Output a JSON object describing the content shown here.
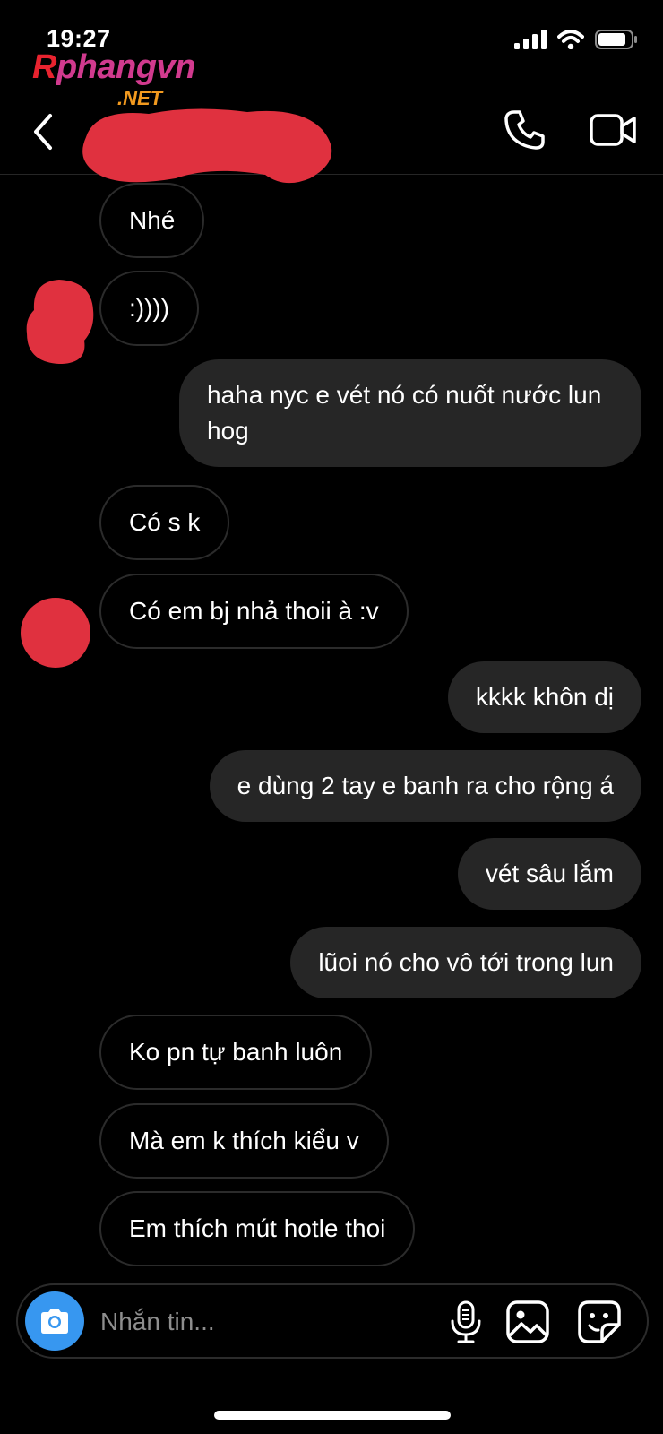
{
  "status_bar": {
    "time": "19:27",
    "icons": [
      "signal-icon",
      "wifi-icon",
      "battery-icon"
    ]
  },
  "watermark": {
    "main_r": "R",
    "main_rest": "phangvn",
    "sub": ".NET"
  },
  "header": {
    "back_icon": "chevron-left-icon",
    "call_icon": "phone-icon",
    "video_icon": "video-camera-icon",
    "redaction_color": "#e0313f"
  },
  "messages": [
    {
      "side": "in",
      "text": "Nhé"
    },
    {
      "side": "in",
      "text": ":))))"
    },
    {
      "side": "out",
      "text": "haha nyc e vét nó có nuốt nước lun hog"
    },
    {
      "side": "in",
      "text": "Có s k"
    },
    {
      "side": "in",
      "text": "Có em bj nhả thoii à :v"
    },
    {
      "side": "out",
      "text": "kkkk khôn dị"
    },
    {
      "side": "out",
      "text": "e dùng 2 tay e banh ra cho rộng á"
    },
    {
      "side": "out",
      "text": "vét sâu lắm"
    },
    {
      "side": "out",
      "text": "lũoi nó cho vô tới trong lun"
    },
    {
      "side": "in",
      "text": "Ko pn tự banh luôn"
    },
    {
      "side": "in",
      "text": "Mà em k thích kiểu v"
    },
    {
      "side": "in",
      "text": "Em thích mút hotle thoi"
    }
  ],
  "composer": {
    "placeholder": "Nhắn tin...",
    "camera_icon": "camera-icon",
    "mic_icon": "microphone-icon",
    "gallery_icon": "image-icon",
    "sticker_icon": "sticker-icon",
    "accent": "#3797f0"
  }
}
